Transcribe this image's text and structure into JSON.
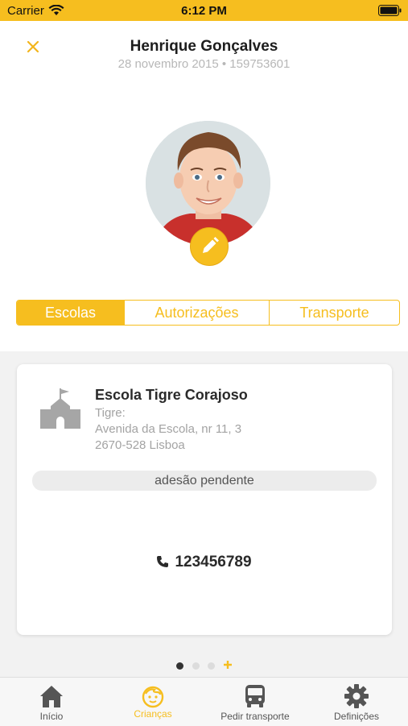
{
  "status_bar": {
    "carrier": "Carrier",
    "time": "6:12 PM"
  },
  "header": {
    "close_icon": "close-icon",
    "title": "Henrique Gonçalves",
    "subtitle": "28 novembro 2015 • 159753601"
  },
  "avatar": {
    "edit_icon": "pencil-icon"
  },
  "tabs": [
    {
      "label": "Escolas",
      "active": true
    },
    {
      "label": "Autorizações",
      "active": false
    },
    {
      "label": "Transporte",
      "active": false
    }
  ],
  "school_card": {
    "icon": "school-building-icon",
    "name": "Escola Tigre Corajoso",
    "address_lines": [
      "Tigre:",
      "Avenida da Escola, nr 11, 3",
      "2670-528 Lisboa"
    ],
    "status": "adesão pendente",
    "phone": "123456789"
  },
  "pager": {
    "count": 3,
    "active_index": 0,
    "add_icon": "plus-icon"
  },
  "tab_bar": [
    {
      "label": "Início",
      "icon": "home-icon",
      "active": false
    },
    {
      "label": "Crianças",
      "icon": "child-face-icon",
      "active": true
    },
    {
      "label": "Pedir transporte",
      "icon": "bus-icon",
      "active": false
    },
    {
      "label": "Definições",
      "icon": "gear-icon",
      "active": false
    }
  ],
  "colors": {
    "accent": "#F6BE1F",
    "inactive_tab": "#555555"
  }
}
